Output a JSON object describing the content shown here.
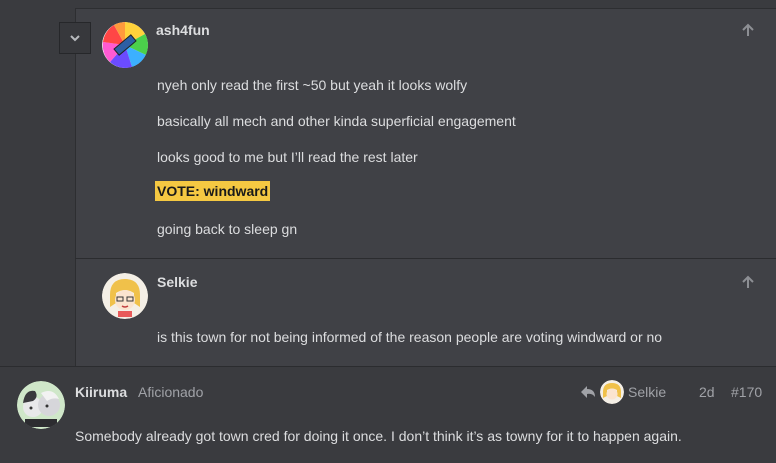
{
  "quote1": {
    "username": "ash4fun",
    "lines": [
      "nyeh only read the first ~50 but yeah it looks wolfy",
      "basically all mech and other kinda superficial engagement",
      "looks good to me but I’ll read the rest later",
      "VOTE: windward",
      "going back to sleep gn"
    ]
  },
  "quote2": {
    "username": "Selkie",
    "text": "is this town for not being informed of the reason people are voting windward or no"
  },
  "post": {
    "username": "Kiiruma",
    "title": "Aficionado",
    "reply_to": "Selkie",
    "age": "2d",
    "number": "#170",
    "text": "Somebody already got town cred for doing it once. I don’t think it’s as towny for it to happen again."
  },
  "colors": {
    "vote_highlight": "#f5c842",
    "background": "#3a3b3f",
    "quote_bg": "#404146"
  }
}
